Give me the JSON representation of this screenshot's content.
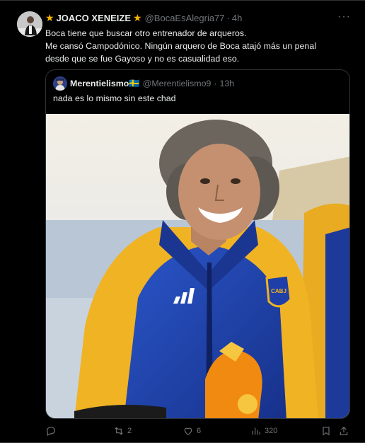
{
  "tweet": {
    "star_left": "★",
    "display_name": "JOACO XENEIZE",
    "star_right": "★",
    "handle": "@BocaEsAlegria77",
    "dot": "·",
    "time": "4h",
    "more": "···",
    "lines": [
      "Boca tiene que buscar otro entrenador de arqueros.",
      "Me cansó Campodónico. Ningún arquero de Boca atajó más un penal",
      "desde que se fue Gayoso y no es casualidad eso."
    ]
  },
  "quote": {
    "display_name": "Merentielismo",
    "flag": "🇸🇪",
    "handle": "@Merentielismo9",
    "dot": "·",
    "time": "13h",
    "text": "nada es lo mismo sin este chad",
    "photo_badge": "CABJ"
  },
  "actions": {
    "reply": {
      "icon": "reply-icon",
      "count": ""
    },
    "retweet": {
      "icon": "retweet-icon",
      "count": "2"
    },
    "like": {
      "icon": "heart-icon",
      "count": "6"
    },
    "views": {
      "icon": "views-icon",
      "count": "320"
    },
    "bookmark": {
      "icon": "bookmark-icon"
    },
    "share": {
      "icon": "share-icon"
    }
  },
  "colors": {
    "background": "#000000",
    "text": "#e7e9ea",
    "muted": "#71767b",
    "border": "#2f3336",
    "star": "#f5b301",
    "jacket_blue": "#1f3fa8",
    "jacket_yellow": "#f0b323"
  }
}
